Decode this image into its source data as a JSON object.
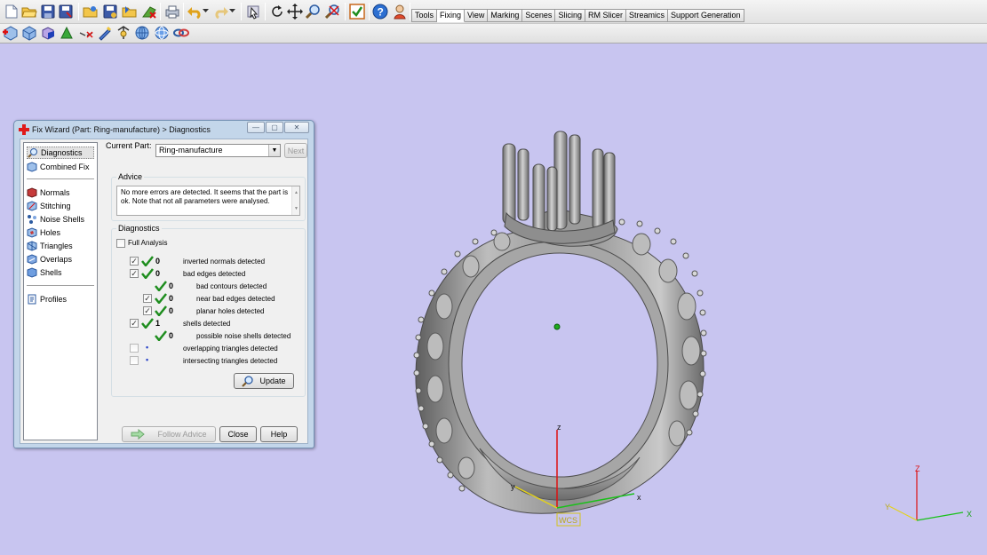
{
  "toolbar": {
    "row1_icons": [
      "new-file-icon",
      "open-folder-icon",
      "save-icon",
      "save-as-icon",
      "open-scene-icon",
      "save-scene-icon",
      "import-icon",
      "exit-icon",
      "print-icon",
      "undo-icon",
      "redo-icon",
      "select-icon",
      "rotate-icon",
      "pan-icon",
      "zoom-icon",
      "zoom-window-icon",
      "check-icon",
      "help-icon",
      "wizard-icon"
    ],
    "row2_icons": [
      "fix-wizard-icon",
      "shell-icon",
      "box-icon",
      "green-triangle-icon",
      "cut-icon",
      "marker-icon",
      "measure-icon",
      "globe-icon",
      "sphere-icon",
      "link-icon"
    ]
  },
  "tabs": [
    "Tools",
    "Fixing",
    "View",
    "Marking",
    "Scenes",
    "Slicing",
    "RM Slicer",
    "Streamics",
    "Support Generation"
  ],
  "active_tab": "Fixing",
  "dialog": {
    "title": "Fix Wizard (Part: Ring-manufacture) > Diagnostics",
    "nav": {
      "group1": [
        "Diagnostics",
        "Combined Fix"
      ],
      "group2": [
        "Normals",
        "Stitching",
        "Noise Shells",
        "Holes",
        "Triangles",
        "Overlaps",
        "Shells"
      ],
      "group3": [
        "Profiles"
      ]
    },
    "current_part_label": "Current Part:",
    "current_part_value": "Ring-manufacture",
    "next_label": "Next",
    "advice_title": "Advice",
    "advice_text": "No more errors are detected. It seems that the part is ok. Note that not all parameters were analysed.",
    "diagnostics_title": "Diagnostics",
    "full_analysis_label": "Full Analysis",
    "rows": [
      {
        "label": "inverted normals detected",
        "count": "0",
        "checked": true,
        "ok": true,
        "indent": 0
      },
      {
        "label": "bad edges detected",
        "count": "0",
        "checked": true,
        "ok": true,
        "indent": 0
      },
      {
        "label": "bad contours detected",
        "count": "0",
        "checked": false,
        "ok": true,
        "indent": 1
      },
      {
        "label": "near bad edges detected",
        "count": "0",
        "checked": true,
        "ok": true,
        "indent": 1
      },
      {
        "label": "planar holes detected",
        "count": "0",
        "checked": true,
        "ok": true,
        "indent": 1
      },
      {
        "label": "shells detected",
        "count": "1",
        "checked": true,
        "ok": true,
        "indent": 0
      },
      {
        "label": "possible noise shells detected",
        "count": "0",
        "checked": false,
        "ok": true,
        "indent": 1
      },
      {
        "label": "overlapping triangles detected",
        "count": "",
        "checked": false,
        "ok": false,
        "indent": 0
      },
      {
        "label": "intersecting triangles detected",
        "count": "",
        "checked": false,
        "ok": false,
        "indent": 0
      }
    ],
    "update_label": "Update",
    "follow_advice_label": "Follow Advice",
    "close_label": "Close",
    "help_label": "Help"
  },
  "viewport": {
    "background": "#c8c5f0",
    "axis_labels": {
      "z": "z",
      "y": "y",
      "x": "x",
      "wcs": "WCS"
    },
    "corner_axis_labels": {
      "z": "Z",
      "y": "Y",
      "x": "X"
    }
  }
}
